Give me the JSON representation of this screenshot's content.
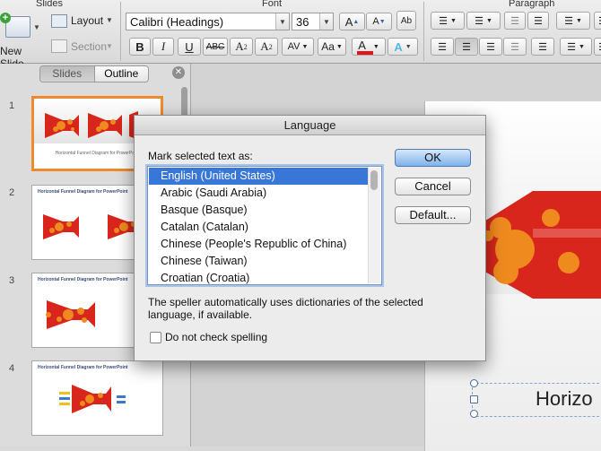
{
  "ribbon": {
    "groups": {
      "slides": "Slides",
      "font": "Font",
      "paragraph": "Paragraph"
    },
    "new_slide": "New Slide",
    "layout": "Layout",
    "section": "Section",
    "font_name": "Calibri (Headings)",
    "font_size": "36",
    "grow_font": "A",
    "shrink_font": "A",
    "bold": "B",
    "italic": "I",
    "underline": "U",
    "strikethrough": "ABC",
    "superscript": "A",
    "superscript_mark": "2",
    "subscript": "A",
    "subscript_mark": "2",
    "char_spacing": "AV",
    "change_case": "Aa",
    "font_color": "A",
    "text_effects": "A",
    "clear_format": "Ab"
  },
  "left_pane": {
    "tabs": [
      "Slides",
      "Outline"
    ],
    "slides": [
      {
        "num": "1",
        "title": "",
        "caption": "Horizontal Funnel Diagram for PowerPoint"
      },
      {
        "num": "2",
        "title": "Horizontal Funnel Diagram for PowerPoint",
        "caption": ""
      },
      {
        "num": "3",
        "title": "Horizontal Funnel Diagram for PowerPoint",
        "caption": ""
      },
      {
        "num": "4",
        "title": "Horizontal Funnel Diagram for PowerPoint",
        "caption": ""
      }
    ]
  },
  "editor": {
    "title_text": "Horizo"
  },
  "dialog": {
    "title": "Language",
    "prompt": "Mark selected text as:",
    "languages": [
      "English (United States)",
      "Arabic (Saudi Arabia)",
      "Basque (Basque)",
      "Catalan (Catalan)",
      "Chinese (People's Republic of China)",
      "Chinese (Taiwan)",
      "Croatian (Croatia)"
    ],
    "selected_index": 0,
    "ok": "OK",
    "cancel": "Cancel",
    "default": "Default...",
    "info_line1": "The speller automatically uses dictionaries of the selected",
    "info_line2": "language, if available.",
    "do_not_check": "Do not check spelling",
    "do_not_check_checked": false
  },
  "colors": {
    "selection": "#3877d7",
    "funnel_red": "#d8261c",
    "funnel_orange": "#ef8a1f",
    "thumb_selected_border": "#f08a2c",
    "font_color_bar": "#e0161b"
  }
}
